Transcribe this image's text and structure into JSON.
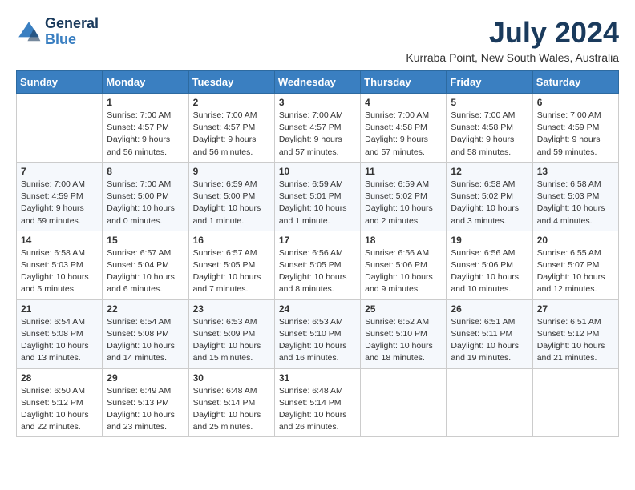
{
  "app": {
    "name": "GeneralBlue",
    "logo_text_1": "General",
    "logo_text_2": "Blue"
  },
  "header": {
    "month_year": "July 2024",
    "location": "Kurraba Point, New South Wales, Australia"
  },
  "weekdays": [
    "Sunday",
    "Monday",
    "Tuesday",
    "Wednesday",
    "Thursday",
    "Friday",
    "Saturday"
  ],
  "weeks": [
    [
      {
        "day": "",
        "sunrise": "",
        "sunset": "",
        "daylight": ""
      },
      {
        "day": "1",
        "sunrise": "Sunrise: 7:00 AM",
        "sunset": "Sunset: 4:57 PM",
        "daylight": "Daylight: 9 hours and 56 minutes."
      },
      {
        "day": "2",
        "sunrise": "Sunrise: 7:00 AM",
        "sunset": "Sunset: 4:57 PM",
        "daylight": "Daylight: 9 hours and 56 minutes."
      },
      {
        "day": "3",
        "sunrise": "Sunrise: 7:00 AM",
        "sunset": "Sunset: 4:57 PM",
        "daylight": "Daylight: 9 hours and 57 minutes."
      },
      {
        "day": "4",
        "sunrise": "Sunrise: 7:00 AM",
        "sunset": "Sunset: 4:58 PM",
        "daylight": "Daylight: 9 hours and 57 minutes."
      },
      {
        "day": "5",
        "sunrise": "Sunrise: 7:00 AM",
        "sunset": "Sunset: 4:58 PM",
        "daylight": "Daylight: 9 hours and 58 minutes."
      },
      {
        "day": "6",
        "sunrise": "Sunrise: 7:00 AM",
        "sunset": "Sunset: 4:59 PM",
        "daylight": "Daylight: 9 hours and 59 minutes."
      }
    ],
    [
      {
        "day": "7",
        "sunrise": "Sunrise: 7:00 AM",
        "sunset": "Sunset: 4:59 PM",
        "daylight": "Daylight: 9 hours and 59 minutes."
      },
      {
        "day": "8",
        "sunrise": "Sunrise: 7:00 AM",
        "sunset": "Sunset: 5:00 PM",
        "daylight": "Daylight: 10 hours and 0 minutes."
      },
      {
        "day": "9",
        "sunrise": "Sunrise: 6:59 AM",
        "sunset": "Sunset: 5:00 PM",
        "daylight": "Daylight: 10 hours and 1 minute."
      },
      {
        "day": "10",
        "sunrise": "Sunrise: 6:59 AM",
        "sunset": "Sunset: 5:01 PM",
        "daylight": "Daylight: 10 hours and 1 minute."
      },
      {
        "day": "11",
        "sunrise": "Sunrise: 6:59 AM",
        "sunset": "Sunset: 5:02 PM",
        "daylight": "Daylight: 10 hours and 2 minutes."
      },
      {
        "day": "12",
        "sunrise": "Sunrise: 6:58 AM",
        "sunset": "Sunset: 5:02 PM",
        "daylight": "Daylight: 10 hours and 3 minutes."
      },
      {
        "day": "13",
        "sunrise": "Sunrise: 6:58 AM",
        "sunset": "Sunset: 5:03 PM",
        "daylight": "Daylight: 10 hours and 4 minutes."
      }
    ],
    [
      {
        "day": "14",
        "sunrise": "Sunrise: 6:58 AM",
        "sunset": "Sunset: 5:03 PM",
        "daylight": "Daylight: 10 hours and 5 minutes."
      },
      {
        "day": "15",
        "sunrise": "Sunrise: 6:57 AM",
        "sunset": "Sunset: 5:04 PM",
        "daylight": "Daylight: 10 hours and 6 minutes."
      },
      {
        "day": "16",
        "sunrise": "Sunrise: 6:57 AM",
        "sunset": "Sunset: 5:05 PM",
        "daylight": "Daylight: 10 hours and 7 minutes."
      },
      {
        "day": "17",
        "sunrise": "Sunrise: 6:56 AM",
        "sunset": "Sunset: 5:05 PM",
        "daylight": "Daylight: 10 hours and 8 minutes."
      },
      {
        "day": "18",
        "sunrise": "Sunrise: 6:56 AM",
        "sunset": "Sunset: 5:06 PM",
        "daylight": "Daylight: 10 hours and 9 minutes."
      },
      {
        "day": "19",
        "sunrise": "Sunrise: 6:56 AM",
        "sunset": "Sunset: 5:06 PM",
        "daylight": "Daylight: 10 hours and 10 minutes."
      },
      {
        "day": "20",
        "sunrise": "Sunrise: 6:55 AM",
        "sunset": "Sunset: 5:07 PM",
        "daylight": "Daylight: 10 hours and 12 minutes."
      }
    ],
    [
      {
        "day": "21",
        "sunrise": "Sunrise: 6:54 AM",
        "sunset": "Sunset: 5:08 PM",
        "daylight": "Daylight: 10 hours and 13 minutes."
      },
      {
        "day": "22",
        "sunrise": "Sunrise: 6:54 AM",
        "sunset": "Sunset: 5:08 PM",
        "daylight": "Daylight: 10 hours and 14 minutes."
      },
      {
        "day": "23",
        "sunrise": "Sunrise: 6:53 AM",
        "sunset": "Sunset: 5:09 PM",
        "daylight": "Daylight: 10 hours and 15 minutes."
      },
      {
        "day": "24",
        "sunrise": "Sunrise: 6:53 AM",
        "sunset": "Sunset: 5:10 PM",
        "daylight": "Daylight: 10 hours and 16 minutes."
      },
      {
        "day": "25",
        "sunrise": "Sunrise: 6:52 AM",
        "sunset": "Sunset: 5:10 PM",
        "daylight": "Daylight: 10 hours and 18 minutes."
      },
      {
        "day": "26",
        "sunrise": "Sunrise: 6:51 AM",
        "sunset": "Sunset: 5:11 PM",
        "daylight": "Daylight: 10 hours and 19 minutes."
      },
      {
        "day": "27",
        "sunrise": "Sunrise: 6:51 AM",
        "sunset": "Sunset: 5:12 PM",
        "daylight": "Daylight: 10 hours and 21 minutes."
      }
    ],
    [
      {
        "day": "28",
        "sunrise": "Sunrise: 6:50 AM",
        "sunset": "Sunset: 5:12 PM",
        "daylight": "Daylight: 10 hours and 22 minutes."
      },
      {
        "day": "29",
        "sunrise": "Sunrise: 6:49 AM",
        "sunset": "Sunset: 5:13 PM",
        "daylight": "Daylight: 10 hours and 23 minutes."
      },
      {
        "day": "30",
        "sunrise": "Sunrise: 6:48 AM",
        "sunset": "Sunset: 5:14 PM",
        "daylight": "Daylight: 10 hours and 25 minutes."
      },
      {
        "day": "31",
        "sunrise": "Sunrise: 6:48 AM",
        "sunset": "Sunset: 5:14 PM",
        "daylight": "Daylight: 10 hours and 26 minutes."
      },
      {
        "day": "",
        "sunrise": "",
        "sunset": "",
        "daylight": ""
      },
      {
        "day": "",
        "sunrise": "",
        "sunset": "",
        "daylight": ""
      },
      {
        "day": "",
        "sunrise": "",
        "sunset": "",
        "daylight": ""
      }
    ]
  ]
}
